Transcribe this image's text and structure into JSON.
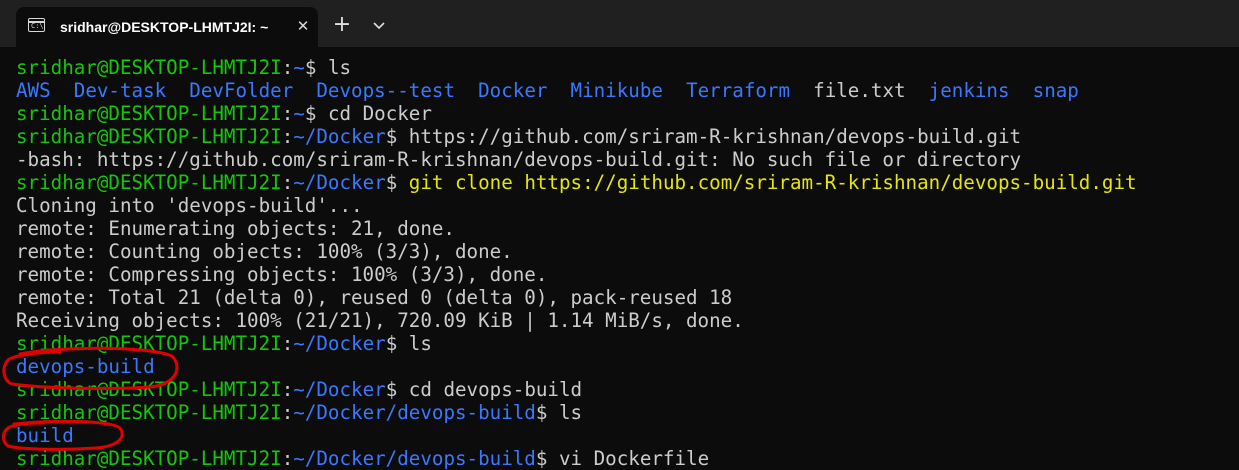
{
  "window": {
    "tab_title": "sridhar@DESKTOP-LHMTJ2I: ~",
    "tab_icon": "terminal-icon",
    "close_glyph": "✕",
    "new_tab_glyph": "+",
    "dropdown_icon": "chevron-down-icon"
  },
  "terminal": {
    "user": "sridhar@DESKTOP-LHMTJ2I",
    "colors": {
      "user": "#16c60c",
      "path": "#3b78ff",
      "directory": "#3b78ff",
      "text": "#cccccc",
      "command_highlight": "#e5e510",
      "annotation": "#e00000"
    },
    "lines": [
      {
        "type": "prompt",
        "path": "~",
        "cmd": "ls"
      },
      {
        "type": "ls",
        "items": [
          {
            "name": "AWS",
            "dir": true
          },
          {
            "name": "Dev-task",
            "dir": true
          },
          {
            "name": "DevFolder",
            "dir": true
          },
          {
            "name": "Devops--test",
            "dir": true
          },
          {
            "name": "Docker",
            "dir": true
          },
          {
            "name": "Minikube",
            "dir": true
          },
          {
            "name": "Terraform",
            "dir": true
          },
          {
            "name": "file.txt",
            "dir": false
          },
          {
            "name": "jenkins",
            "dir": true
          },
          {
            "name": "snap",
            "dir": true
          }
        ]
      },
      {
        "type": "prompt",
        "path": "~",
        "cmd": "cd Docker"
      },
      {
        "type": "prompt",
        "path": "~/Docker",
        "cmd": "https://github.com/sriram-R-krishnan/devops-build.git"
      },
      {
        "type": "output",
        "text": "-bash: https://github.com/sriram-R-krishnan/devops-build.git: No such file or directory"
      },
      {
        "type": "prompt",
        "path": "~/Docker",
        "cmd": "git clone https://github.com/sriram-R-krishnan/devops-build.git",
        "highlight": true
      },
      {
        "type": "output",
        "text": "Cloning into 'devops-build'..."
      },
      {
        "type": "output",
        "text": "remote: Enumerating objects: 21, done."
      },
      {
        "type": "output",
        "text": "remote: Counting objects: 100% (3/3), done."
      },
      {
        "type": "output",
        "text": "remote: Compressing objects: 100% (3/3), done."
      },
      {
        "type": "output",
        "text": "remote: Total 21 (delta 0), reused 0 (delta 0), pack-reused 18"
      },
      {
        "type": "output",
        "text": "Receiving objects: 100% (21/21), 720.09 KiB | 1.14 MiB/s, done."
      },
      {
        "type": "prompt",
        "path": "~/Docker",
        "cmd": "ls"
      },
      {
        "type": "ls",
        "items": [
          {
            "name": "devops-build",
            "dir": true
          }
        ]
      },
      {
        "type": "prompt",
        "path": "~/Docker",
        "cmd": "cd devops-build"
      },
      {
        "type": "prompt",
        "path": "~/Docker/devops-build",
        "cmd": "ls"
      },
      {
        "type": "ls",
        "items": [
          {
            "name": "build",
            "dir": true
          }
        ]
      },
      {
        "type": "prompt",
        "path": "~/Docker/devops-build",
        "cmd": "vi Dockerfile"
      }
    ]
  }
}
